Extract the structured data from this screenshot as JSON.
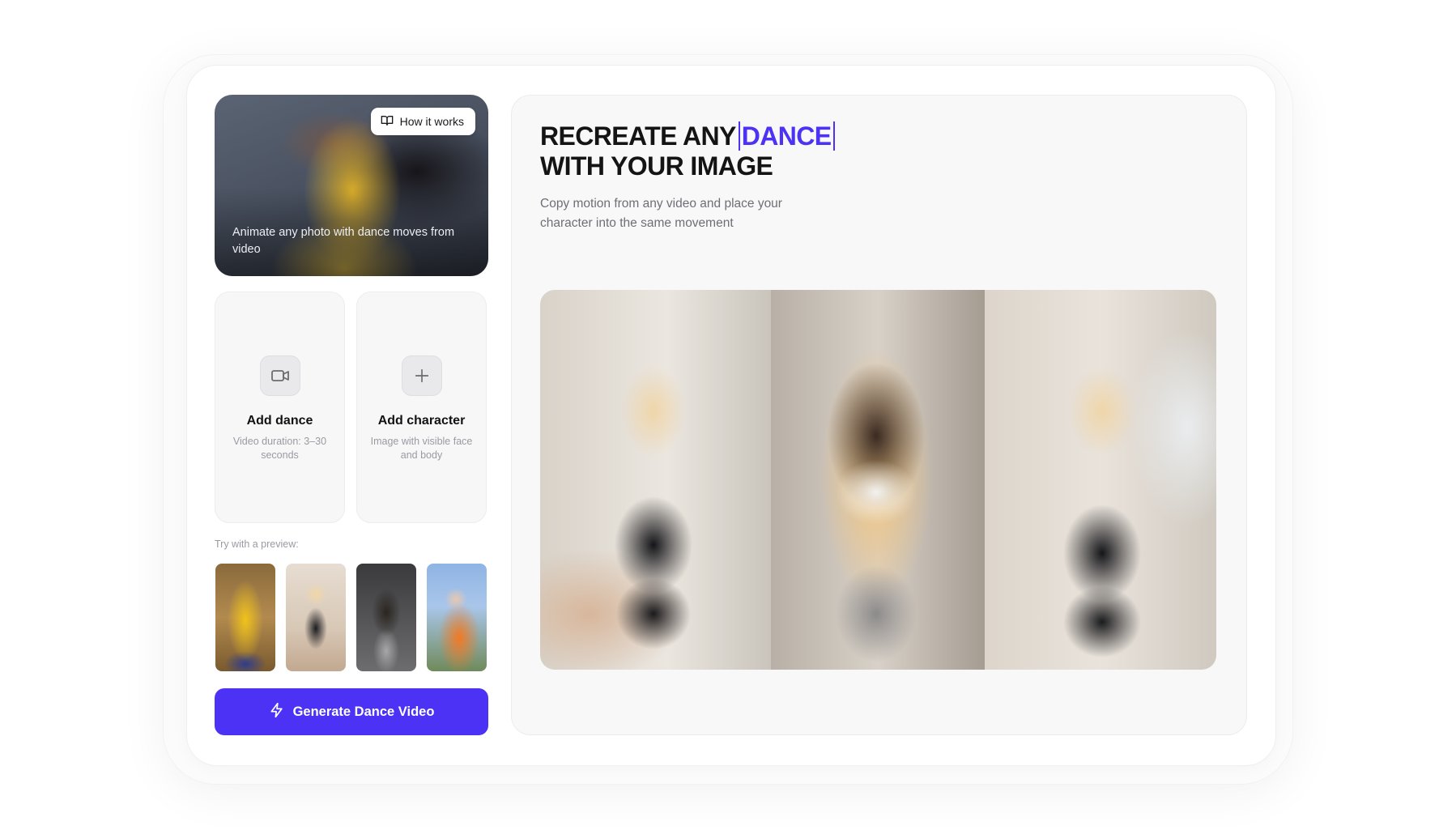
{
  "hero": {
    "how_it_works": "How it works",
    "caption": "Animate any photo with dance moves from video"
  },
  "upload_dance": {
    "title": "Add dance",
    "subtitle": "Video duration: 3–30 seconds",
    "icon": "video-camera-icon"
  },
  "upload_character": {
    "title": "Add character",
    "subtitle": "Image with visible face and body",
    "icon": "plus-icon"
  },
  "preview_section": {
    "label": "Try with a preview:"
  },
  "generate_button": {
    "label": "Generate Dance Video",
    "icon": "lightning-icon"
  },
  "headline": {
    "line1_prefix": "RECREATE ANY",
    "line1_accent": "DANCE",
    "line2": "WITH YOUR IMAGE"
  },
  "subtitle": "Copy motion from any video and place your character into the same movement",
  "colors": {
    "accent": "#4b32f5",
    "text_primary": "#141414",
    "text_muted": "#6e6e76"
  }
}
